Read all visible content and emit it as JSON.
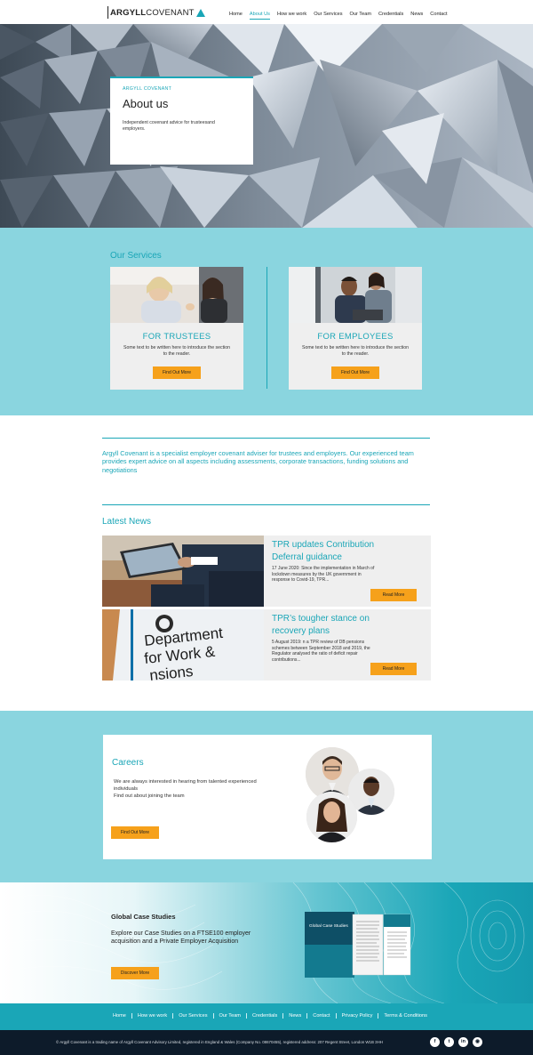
{
  "header": {
    "logo_bold": "ARGYLL",
    "logo_thin": "COVENANT",
    "nav": [
      {
        "label": "Home",
        "active": false
      },
      {
        "label": "About Us",
        "active": true
      },
      {
        "label": "How we work",
        "active": false
      },
      {
        "label": "Our Services",
        "active": false
      },
      {
        "label": "Our Team",
        "active": false
      },
      {
        "label": "Credentials",
        "active": false
      },
      {
        "label": "News",
        "active": false
      },
      {
        "label": "Contact",
        "active": false
      }
    ]
  },
  "hero": {
    "eyebrow": "ARGYLL COVENANT",
    "title": "About us",
    "subtitle": "Independent covenant advice for trusteesand employers."
  },
  "services": {
    "title": "Our Services",
    "cards": [
      {
        "title": "FOR TRUSTEES",
        "text": "Some text to be written here to introduce the section to the reader.",
        "button": "Find Out More"
      },
      {
        "title": "FOR EMPLOYEES",
        "text": "Some text to be written here to introduce the section to the reader.",
        "button": "Find Out More"
      }
    ]
  },
  "about": {
    "text": "Argyll Covenant is a specialist employer covenant adviser for trustees and employers. Our experienced team provides expert advice on all aspects including assessments, corporate transactions, funding solutions and negotiations"
  },
  "news": {
    "title": "Latest News",
    "items": [
      {
        "title": "TPR updates Contribution Deferral guidance",
        "body": "17 June 2020:  Since the implementation in March of lockdown measures by the UK government in response to Covid-19, TPR...",
        "button": "Read More"
      },
      {
        "title": "TPR’s tougher stance on recovery plans",
        "body": "5 August 2019:  n a TPR review of DB pensions schemes between September 2018 and 2019, the Regulator analysed the ratio of deficit repair contributions...",
        "button": "Read More"
      }
    ],
    "image2_text": [
      "Department",
      "for Work &",
      "nsions"
    ]
  },
  "careers": {
    "title": "Careers",
    "text_line1": "We are always interested in hearing from talented experienced individuals",
    "text_line2": "Find out about joining the team",
    "button": "Find Out More"
  },
  "case_studies": {
    "title": "Global Case Studies",
    "text": "Explore our Case Studies on a FTSE100 employer acquisition and a Private Employer Acquisition",
    "button": "Discover More",
    "brochure_label": "Global Case Studies"
  },
  "footer": {
    "links": [
      "Home",
      "How we work",
      "Our Services",
      "Our Team",
      "Credentials",
      "News",
      "Contact",
      "Privacy Policy",
      "Terms & Conditions"
    ],
    "legal": "© Argyll Covenant is a trading name of Argyll Covenant Advisory Limited, registered in England & Wales (Company No. 08670455), registered address: 207 Regent Street, London W1B 3HH",
    "socials": [
      {
        "icon": "facebook-icon",
        "glyph": "f"
      },
      {
        "icon": "twitter-icon",
        "glyph": "t"
      },
      {
        "icon": "linkedin-icon",
        "glyph": "in"
      },
      {
        "icon": "rss-icon",
        "glyph": "◉"
      }
    ]
  },
  "colors": {
    "accent": "#1aa6b7",
    "light_teal": "#8ad5df",
    "button": "#f6a11b",
    "footer_dark": "#0d1b2a"
  }
}
